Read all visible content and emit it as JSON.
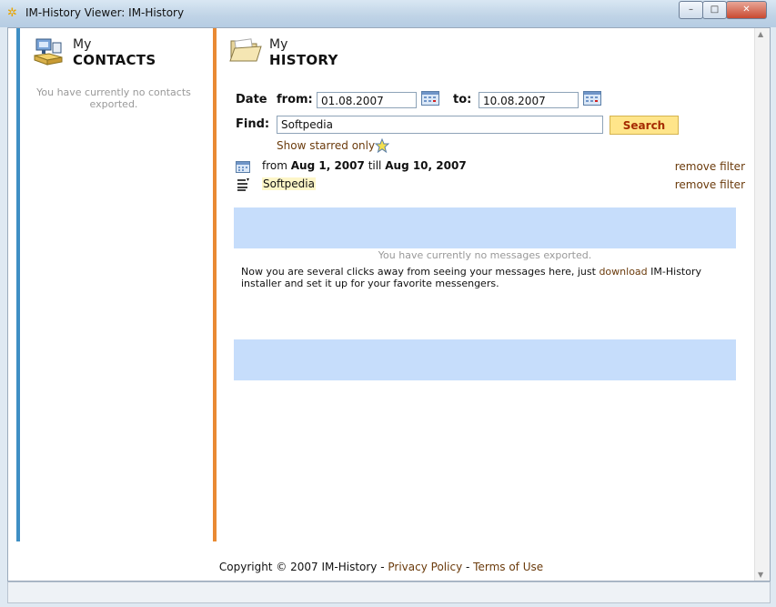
{
  "window": {
    "title": "IM-History Viewer: IM-History",
    "controls": {
      "minimize": "–",
      "maximize": "□",
      "close": "✕"
    },
    "app_icon": "sparkle-icon"
  },
  "contacts": {
    "heading_small": "My",
    "heading_big": "CONTACTS",
    "empty_text": "You have currently no contacts exported.",
    "icon": "contacts-icon"
  },
  "history": {
    "heading_small": "My",
    "heading_big": "HISTORY",
    "date_label": "Date",
    "from_label": "from:",
    "from_value": "01.08.2007",
    "to_label": "to:",
    "to_value": "10.08.2007",
    "find_label": "Find:",
    "find_value": "Softpedia",
    "search_label": "Search",
    "show_starred": "Show starred only",
    "filters": {
      "date": {
        "prefix": "from",
        "start": "Aug 1, 2007",
        "middle": "till",
        "end": "Aug 10, 2007",
        "remove": "remove filter"
      },
      "text": {
        "value": "Softpedia",
        "remove": "remove filter"
      }
    },
    "no_messages": "You have currently no messages exported.",
    "hint_before": "Now you are several clicks away from seeing your messages here, just",
    "hint_link": "download",
    "hint_after": "IM-History installer and set it up for your favorite messengers."
  },
  "footer": {
    "copyright": "Copyright © 2007 IM-History -",
    "privacy": "Privacy Policy",
    "separator": "-",
    "terms": "Terms of Use"
  },
  "colors": {
    "left_bar": "#3f8fc4",
    "mid_bar": "#e98a33",
    "band": "#c6ddfb",
    "link": "#6b3b0c",
    "search_bg": "#ffe58a"
  }
}
